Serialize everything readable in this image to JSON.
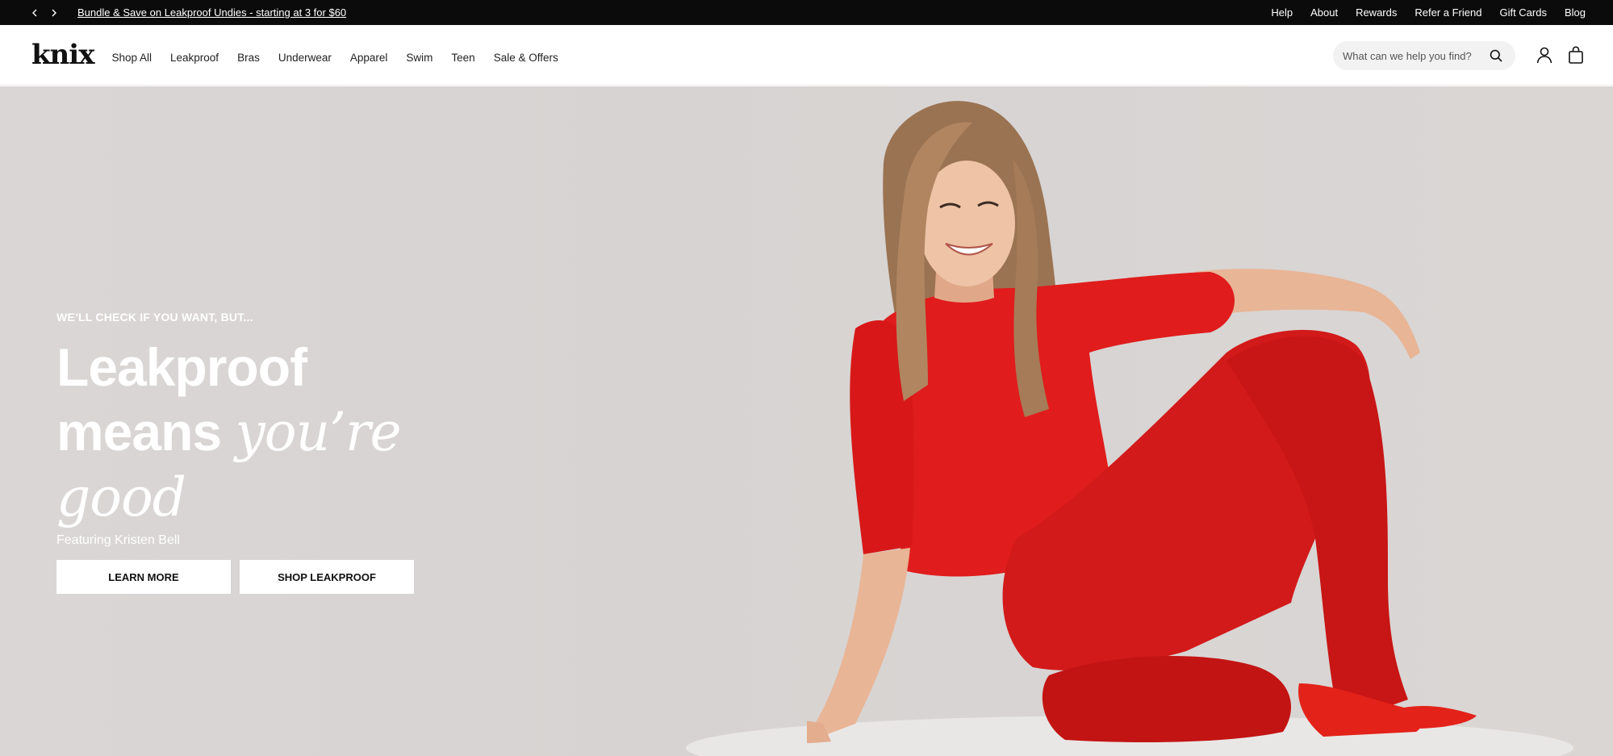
{
  "announcement": {
    "promo_text": "Bundle & Save on Leakproof Undies - starting at 3 for $60",
    "utility_links": [
      "Help",
      "About",
      "Rewards",
      "Refer a Friend",
      "Gift Cards",
      "Blog"
    ]
  },
  "header": {
    "logo": "knix",
    "nav": [
      "Shop All",
      "Leakproof",
      "Bras",
      "Underwear",
      "Apparel",
      "Swim",
      "Teen",
      "Sale & Offers"
    ],
    "search_placeholder": "What can we help you find?"
  },
  "hero": {
    "eyebrow": "WE’LL CHECK IF YOU WANT, BUT...",
    "headline_line1": "Leakproof",
    "headline_line2_plain": "means ",
    "headline_line2_italic": "you’re",
    "headline_line3_italic": "good",
    "featuring": "Featuring Kristen Bell",
    "cta_primary": "LEARN MORE",
    "cta_secondary": "SHOP LEAKPROOF"
  },
  "colors": {
    "announcement_bg": "#0b0b0b",
    "hero_bg": "#d8d4d3",
    "outfit_red": "#e01c1c"
  },
  "icons": [
    "chevron-left-icon",
    "chevron-right-icon",
    "search-icon",
    "account-icon",
    "bag-icon"
  ]
}
